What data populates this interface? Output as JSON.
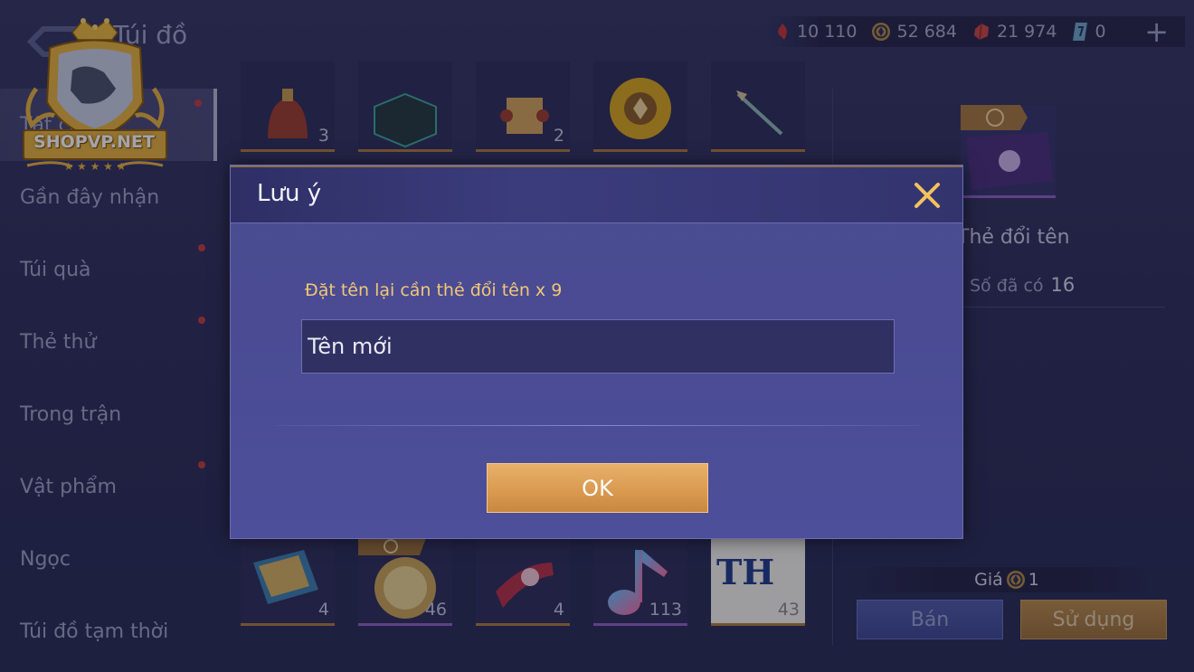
{
  "header": {
    "title": "Túi đồ",
    "currencies": [
      {
        "icon": "red-gem-icon",
        "value": "10 110"
      },
      {
        "icon": "gold-coin-icon",
        "value": "52 684"
      },
      {
        "icon": "ruby-icon",
        "value": "21 974"
      },
      {
        "icon": "blue-card-icon",
        "value": "0"
      }
    ],
    "plus_label": "+"
  },
  "watermark": {
    "text": "SHOPVP.NET"
  },
  "sidebar": {
    "items": [
      {
        "label": "Tất cả",
        "active": true,
        "badge": true
      },
      {
        "label": "Gần đây nhận",
        "active": false,
        "badge": false
      },
      {
        "label": "Túi quà",
        "active": false,
        "badge": true
      },
      {
        "label": "Thẻ thử",
        "active": false,
        "badge": true
      },
      {
        "label": "Trong trận",
        "active": false,
        "badge": false
      },
      {
        "label": "Vật phẩm",
        "active": false,
        "badge": true
      },
      {
        "label": "Ngọc",
        "active": false,
        "badge": false
      },
      {
        "label": "Túi đồ tạm thời",
        "active": false,
        "badge": false
      }
    ]
  },
  "grid": {
    "top_row": [
      {
        "icon": "helmet-icon",
        "count": "3"
      },
      {
        "icon": "treasure-chest-icon",
        "count": ""
      },
      {
        "icon": "scroll-icon",
        "count": "2"
      },
      {
        "icon": "sunflower-icon",
        "count": ""
      },
      {
        "icon": "spear-icon",
        "count": ""
      }
    ],
    "bottom_row": [
      {
        "icon": "map-scroll-icon",
        "count": "4"
      },
      {
        "icon": "golden-orb-icon",
        "count": "46"
      },
      {
        "icon": "flower-scroll-icon",
        "count": "4"
      },
      {
        "icon": "music-note-icon",
        "count": "113"
      },
      {
        "icon": "th-card-icon",
        "label": "TH",
        "count": "43"
      }
    ]
  },
  "detail": {
    "name": "Thẻ đổi tên",
    "owned_label": "Số đã có",
    "owned_value": "16",
    "price_label": "Giá",
    "price_value": "1",
    "sell_label": "Bán",
    "use_label": "Sử dụng"
  },
  "dialog": {
    "title": "Lưu ý",
    "hint": "Đặt tên lại cần thẻ đổi tên x 9",
    "input_placeholder": "Tên mới",
    "ok_label": "OK"
  }
}
